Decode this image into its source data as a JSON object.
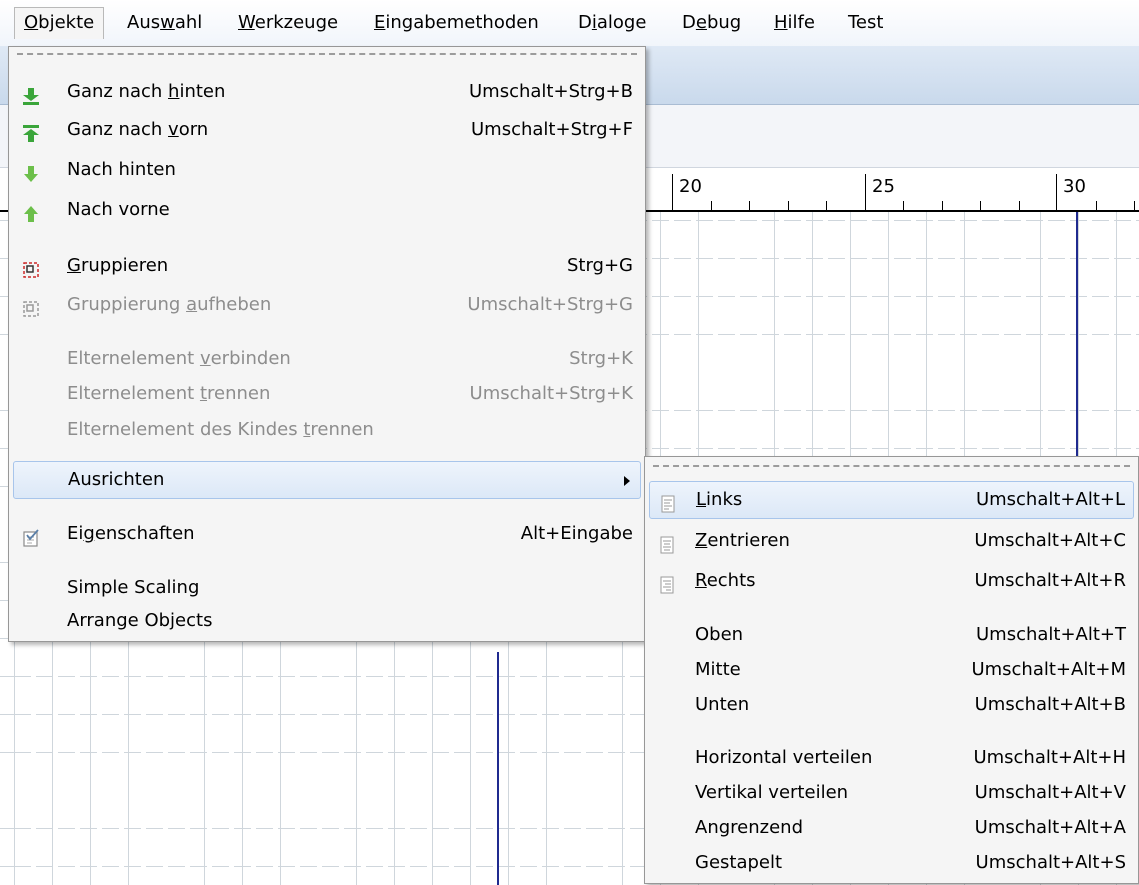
{
  "menubar": {
    "items": [
      {
        "pre": "",
        "u": "O",
        "post": "bjekte"
      },
      {
        "pre": "Aus",
        "u": "w",
        "post": "ahl"
      },
      {
        "pre": "",
        "u": "W",
        "post": "erkzeuge"
      },
      {
        "pre": "",
        "u": "E",
        "post": "ingabemethoden"
      },
      {
        "pre": "D",
        "u": "i",
        "post": "aloge"
      },
      {
        "pre": "D",
        "u": "e",
        "post": "bug"
      },
      {
        "pre": "",
        "u": "H",
        "post": "ilfe"
      },
      {
        "pre": "Test",
        "u": "",
        "post": ""
      }
    ]
  },
  "ruler": {
    "labels": [
      "20",
      "25",
      "30"
    ]
  },
  "objekte_menu": {
    "items": [
      {
        "pre": "Ganz nach ",
        "u": "h",
        "post": "inten",
        "accel": "Umschalt+Strg+B"
      },
      {
        "pre": "Ganz nach ",
        "u": "v",
        "post": "orn",
        "accel": "Umschalt+Strg+F"
      },
      {
        "pre": "Nach hinten",
        "u": "",
        "post": "",
        "accel": ""
      },
      {
        "pre": "Nach vorne",
        "u": "",
        "post": "",
        "accel": ""
      },
      {
        "pre": "",
        "u": "G",
        "post": "ruppieren",
        "accel": "Strg+G"
      },
      {
        "pre": "Gruppierung ",
        "u": "a",
        "post": "ufheben",
        "accel": "Umschalt+Strg+G"
      },
      {
        "pre": "Elternelement ",
        "u": "v",
        "post": "erbinden",
        "accel": "Strg+K"
      },
      {
        "pre": "Elternelement ",
        "u": "t",
        "post": "rennen",
        "accel": "Umschalt+Strg+K"
      },
      {
        "pre": "Elternelement des Kindes ",
        "u": "t",
        "post": "rennen",
        "accel": ""
      },
      {
        "pre": "Ausrichten",
        "u": "",
        "post": "",
        "accel": ""
      },
      {
        "pre": "Ei",
        "u": "g",
        "post": "enschaften",
        "accel": "Alt+Eingabe"
      },
      {
        "pre": "Simple Scaling",
        "u": "",
        "post": "",
        "accel": ""
      },
      {
        "pre": "Arrange Objects",
        "u": "",
        "post": "",
        "accel": ""
      }
    ]
  },
  "ausrichten_menu": {
    "items": [
      {
        "pre": "",
        "u": "L",
        "post": "inks",
        "accel": "Umschalt+Alt+L"
      },
      {
        "pre": "",
        "u": "Z",
        "post": "entrieren",
        "accel": "Umschalt+Alt+C"
      },
      {
        "pre": "",
        "u": "R",
        "post": "echts",
        "accel": "Umschalt+Alt+R"
      },
      {
        "pre": "Oben",
        "u": "",
        "post": "",
        "accel": "Umschalt+Alt+T"
      },
      {
        "pre": "Mitte",
        "u": "",
        "post": "",
        "accel": "Umschalt+Alt+M"
      },
      {
        "pre": "Unten",
        "u": "",
        "post": "",
        "accel": "Umschalt+Alt+B"
      },
      {
        "pre": "Horizontal verteilen",
        "u": "",
        "post": "",
        "accel": "Umschalt+Alt+H"
      },
      {
        "pre": "Vertikal verteilen",
        "u": "",
        "post": "",
        "accel": "Umschalt+Alt+V"
      },
      {
        "pre": "Angrenzend",
        "u": "",
        "post": "",
        "accel": "Umschalt+Alt+A"
      },
      {
        "pre": "Gestapelt",
        "u": "",
        "post": "",
        "accel": "Umschalt+Alt+S"
      }
    ]
  },
  "colors": {
    "menu_bg": "#f5f5f5",
    "highlight_border": "#a8c5eb",
    "guide_line": "#1f2a8f",
    "icon_green": "#3aa53a"
  }
}
